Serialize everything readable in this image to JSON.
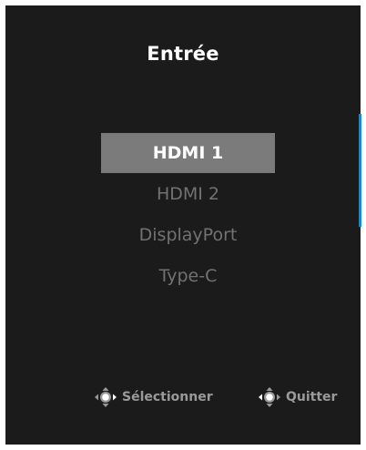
{
  "menu": {
    "title": "Entrée",
    "items": [
      {
        "label": "HDMI 1",
        "selected": true
      },
      {
        "label": "HDMI 2",
        "selected": false
      },
      {
        "label": "DisplayPort",
        "selected": false
      },
      {
        "label": "Type-C",
        "selected": false
      }
    ]
  },
  "hints": {
    "select_label": "Sélectionner",
    "quit_label": "Quitter"
  },
  "icons": {
    "select_hint": "joystick-icon",
    "quit_hint": "joystick-icon"
  },
  "colors": {
    "background": "#1b1b1b",
    "selected_bg": "#7b7b7b",
    "selected_text": "#ffffff",
    "item_text": "#727272",
    "hint_text": "#9a9a9a",
    "accent": "#1c86c9"
  }
}
